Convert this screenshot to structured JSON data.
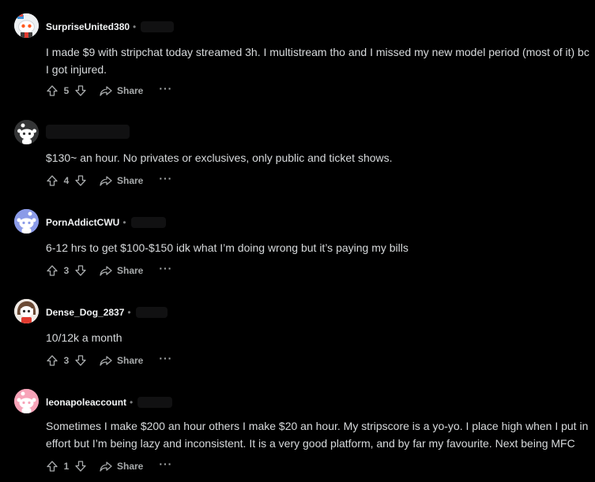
{
  "colors": {
    "background": "#000000",
    "text": "#d7dadc",
    "username": "#f2f4f5",
    "muted": "#a7aaab"
  },
  "comments": [
    {
      "username": "SurpriseUnited380",
      "separator": "•",
      "body": "I made $9 with stripchat today streamed 3h. I multistream tho and I missed my new model period (most of it) bc I got injured.",
      "votes": "5",
      "share_label": "Share",
      "more_label": "···",
      "avatar_icon": "snoo-avatar-icon"
    },
    {
      "username": "",
      "separator": "",
      "body": "$130~ an hour. No privates or exclusives, only public and ticket shows.",
      "votes": "4",
      "share_label": "Share",
      "more_label": "···",
      "avatar_icon": "default-snoo-avatar-icon"
    },
    {
      "username": "PornAddictCWU",
      "separator": "•",
      "body": "6-12 hrs to get $100-$150 idk what I’m doing wrong but it’s paying my bills",
      "votes": "3",
      "share_label": "Share",
      "more_label": "···",
      "avatar_icon": "default-snoo-avatar-icon"
    },
    {
      "username": "Dense_Dog_2837",
      "separator": "•",
      "body": "10/12k a month",
      "votes": "3",
      "share_label": "Share",
      "more_label": "···",
      "avatar_icon": "snoo-avatar-icon"
    },
    {
      "username": "leonapoleaccount",
      "separator": "•",
      "body": "Sometimes I make $200 an hour others I make $20 an hour. My stripscore is a yo-yo. I place high when I put in effort but I’m being lazy and inconsistent. It is a very good platform, and by far my favourite. Next being MFC",
      "votes": "1",
      "share_label": "Share",
      "more_label": "···",
      "avatar_icon": "default-snoo-avatar-icon"
    }
  ]
}
